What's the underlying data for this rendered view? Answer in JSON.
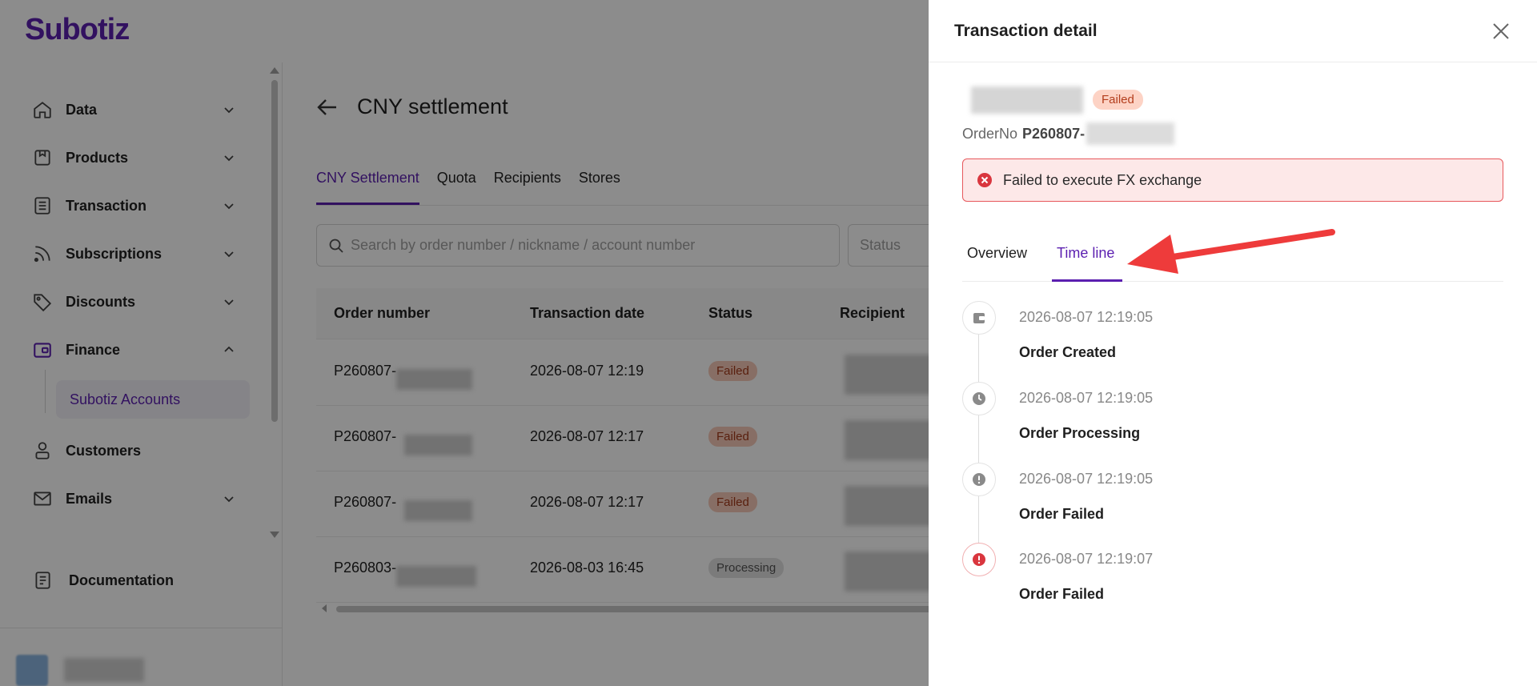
{
  "app": {
    "logo": "Subotiz"
  },
  "sidebar": {
    "items": [
      {
        "label": "Data"
      },
      {
        "label": "Products"
      },
      {
        "label": "Transaction"
      },
      {
        "label": "Subscriptions"
      },
      {
        "label": "Discounts"
      },
      {
        "label": "Finance"
      },
      {
        "label": "Customers"
      },
      {
        "label": "Emails"
      }
    ],
    "sub_item": "Subotiz Accounts",
    "documentation": "Documentation"
  },
  "main": {
    "title": "CNY settlement",
    "tabs": [
      "CNY Settlement",
      "Quota",
      "Recipients",
      "Stores"
    ],
    "search_placeholder": "Search by order number / nickname / account number",
    "status_placeholder": "Status",
    "table": {
      "headers": [
        "Order number",
        "Transaction date",
        "Status",
        "Recipient"
      ],
      "rows": [
        {
          "order": "P260807-",
          "date": "2026-08-07 12:19",
          "status": "Failed"
        },
        {
          "order": "P260807-",
          "date": "2026-08-07 12:17",
          "status": "Failed"
        },
        {
          "order": "P260807-",
          "date": "2026-08-07 12:17",
          "status": "Failed"
        },
        {
          "order": "P260803-",
          "date": "2026-08-03 16:45",
          "status": "Processing"
        }
      ]
    }
  },
  "drawer": {
    "title": "Transaction detail",
    "status": "Failed",
    "order_label": "OrderNo",
    "order_value": "P260807-",
    "alert": "Failed to execute FX exchange",
    "tabs": [
      "Overview",
      "Time line"
    ],
    "timeline": [
      {
        "time": "2026-08-07 12:19:05",
        "event": "Order Created",
        "icon": "wallet-icon"
      },
      {
        "time": "2026-08-07 12:19:05",
        "event": "Order Processing",
        "icon": "clock-icon"
      },
      {
        "time": "2026-08-07 12:19:05",
        "event": "Order Failed",
        "icon": "alert-icon"
      },
      {
        "time": "2026-08-07 12:19:07",
        "event": "Order Failed",
        "icon": "alert-icon"
      }
    ]
  },
  "colors": {
    "brand": "#5b1fb0",
    "failed_bg": "#fdd3c5",
    "alert_border": "#e7585c",
    "annotation_arrow": "#ee3b3b"
  }
}
